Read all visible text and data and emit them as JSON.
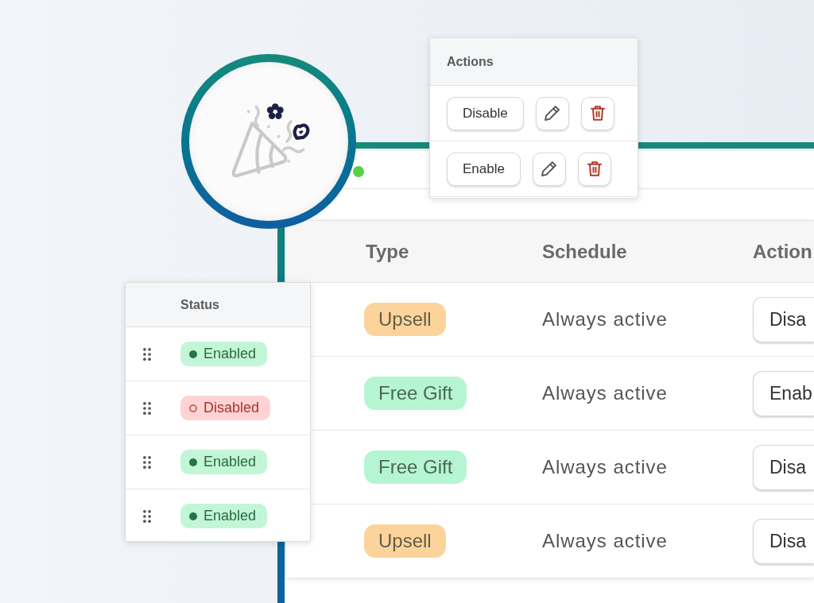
{
  "actions_popover": {
    "title": "Actions",
    "rows": [
      {
        "toggle": "Disable"
      },
      {
        "toggle": "Enable"
      }
    ]
  },
  "table": {
    "columns": [
      "Type",
      "Schedule",
      "Action"
    ],
    "rows": [
      {
        "type": {
          "label": "Upsell",
          "color": "#fcd49b"
        },
        "schedule": "Always active",
        "action": "Disa"
      },
      {
        "type": {
          "label": "Free Gift",
          "color": "#b6f5d2"
        },
        "schedule": "Always active",
        "action": "Enab"
      },
      {
        "type": {
          "label": "Free Gift",
          "color": "#b6f5d2"
        },
        "schedule": "Always active",
        "action": "Disa"
      },
      {
        "type": {
          "label": "Upsell",
          "color": "#fcd49b"
        },
        "schedule": "Always active",
        "action": "Disa"
      }
    ]
  },
  "status_popover": {
    "title": "Status",
    "rows": [
      {
        "label": "Enabled",
        "enabled": true
      },
      {
        "label": "Disabled",
        "enabled": false
      },
      {
        "label": "Enabled",
        "enabled": true
      },
      {
        "label": "Enabled",
        "enabled": true
      }
    ]
  }
}
